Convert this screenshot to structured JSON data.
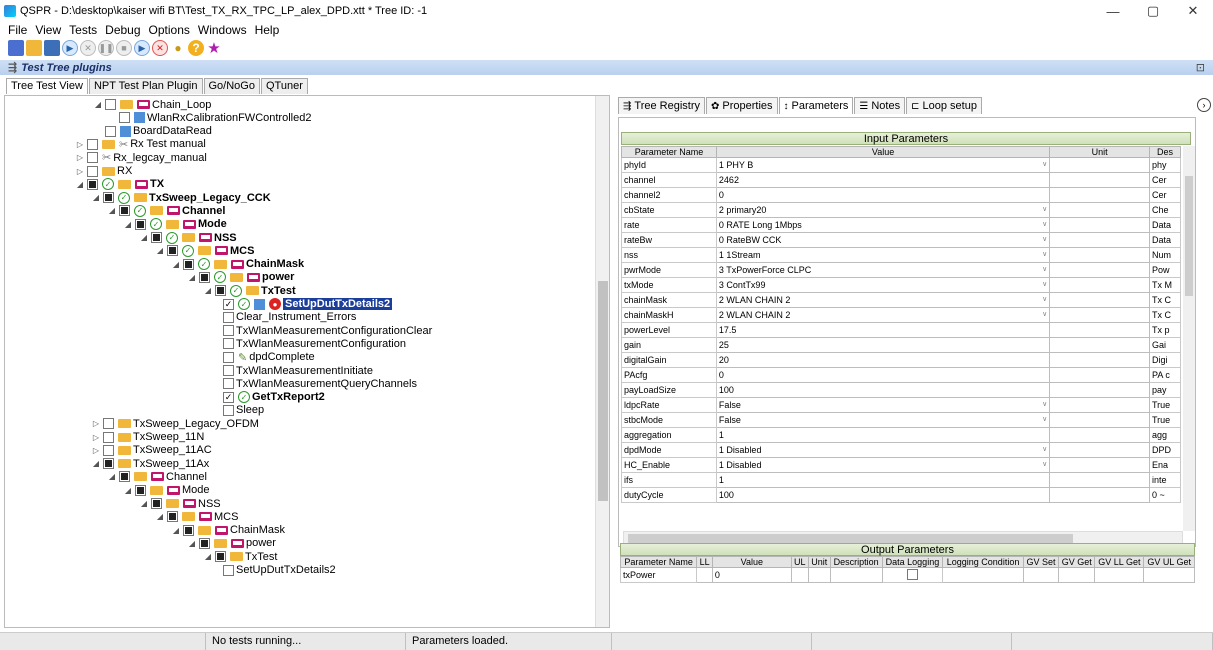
{
  "window": {
    "title": "QSPR - D:\\desktop\\kaiser wifi BT\\Test_TX_RX_TPC_LP_alex_DPD.xtt * Tree ID: -1"
  },
  "menu": [
    "File",
    "View",
    "Tests",
    "Debug",
    "Options",
    "Windows",
    "Help"
  ],
  "plugins": {
    "title": "Test Tree plugins"
  },
  "main_tabs": [
    "Tree Test View",
    "NPT Test Plan Plugin",
    "Go/NoGo",
    "QTuner"
  ],
  "tree": [
    {
      "indent": 88,
      "tw": "◢",
      "cb": "",
      "ok": false,
      "icon": "folder-loop",
      "label": "Chain_Loop",
      "bold": false
    },
    {
      "indent": 112,
      "tw": "",
      "cb": "",
      "ok": false,
      "icon": "blue",
      "label": "WlanRxCalibrationFWControlled2",
      "bold": false
    },
    {
      "indent": 98,
      "tw": "",
      "cb": "",
      "ok": false,
      "icon": "blue",
      "label": "BoardDataRead",
      "bold": false
    },
    {
      "indent": 70,
      "tw": "▷",
      "cb": "",
      "ok": false,
      "icon": "folder-tools",
      "label": "Rx Test manual",
      "bold": false
    },
    {
      "indent": 70,
      "tw": "▷",
      "cb": "",
      "ok": false,
      "icon": "tools",
      "label": "Rx_legcay_manual",
      "bold": false
    },
    {
      "indent": 70,
      "tw": "▷",
      "cb": "",
      "ok": false,
      "icon": "folder",
      "label": "RX",
      "bold": false
    },
    {
      "indent": 70,
      "tw": "◢",
      "cb": "fill",
      "ok": true,
      "icon": "folder-loop",
      "label": "TX",
      "bold": true
    },
    {
      "indent": 86,
      "tw": "◢",
      "cb": "fill",
      "ok": true,
      "icon": "folder",
      "label": "TxSweep_Legacy_CCK",
      "bold": true
    },
    {
      "indent": 102,
      "tw": "◢",
      "cb": "fill",
      "ok": true,
      "icon": "folder-loop",
      "label": "Channel",
      "bold": true
    },
    {
      "indent": 118,
      "tw": "◢",
      "cb": "fill",
      "ok": true,
      "icon": "folder-loop",
      "label": "Mode",
      "bold": true
    },
    {
      "indent": 134,
      "tw": "◢",
      "cb": "fill",
      "ok": true,
      "icon": "folder-loop",
      "label": "NSS",
      "bold": true
    },
    {
      "indent": 150,
      "tw": "◢",
      "cb": "fill",
      "ok": true,
      "icon": "folder-loop",
      "label": "MCS",
      "bold": true
    },
    {
      "indent": 166,
      "tw": "◢",
      "cb": "fill",
      "ok": true,
      "icon": "folder-loop",
      "label": "ChainMask",
      "bold": true
    },
    {
      "indent": 182,
      "tw": "◢",
      "cb": "fill",
      "ok": true,
      "icon": "folder-loop",
      "label": "power",
      "bold": true
    },
    {
      "indent": 198,
      "tw": "◢",
      "cb": "fill",
      "ok": true,
      "icon": "folder",
      "label": "TxTest",
      "bold": true
    },
    {
      "indent": 216,
      "tw": "",
      "cb": "check",
      "ok": true,
      "icon": "selected",
      "label": "SetUpDutTxDetails2",
      "bold": true
    },
    {
      "indent": 216,
      "tw": "",
      "cb": "",
      "ok": false,
      "icon": "none",
      "label": "Clear_Instrument_Errors",
      "bold": false
    },
    {
      "indent": 216,
      "tw": "",
      "cb": "",
      "ok": false,
      "icon": "none",
      "label": "TxWlanMeasurementConfigurationClear",
      "bold": false
    },
    {
      "indent": 216,
      "tw": "",
      "cb": "",
      "ok": false,
      "icon": "none",
      "label": "TxWlanMeasurementConfiguration",
      "bold": false
    },
    {
      "indent": 216,
      "tw": "",
      "cb": "",
      "ok": false,
      "icon": "dpd",
      "label": "dpdComplete",
      "bold": false
    },
    {
      "indent": 216,
      "tw": "",
      "cb": "",
      "ok": false,
      "icon": "none",
      "label": "TxWlanMeasurementInitiate",
      "bold": false
    },
    {
      "indent": 216,
      "tw": "",
      "cb": "",
      "ok": false,
      "icon": "none",
      "label": "TxWlanMeasurementQueryChannels",
      "bold": false
    },
    {
      "indent": 216,
      "tw": "",
      "cb": "check",
      "ok": true,
      "icon": "none",
      "label": "GetTxReport2",
      "bold": true
    },
    {
      "indent": 216,
      "tw": "",
      "cb": "",
      "ok": false,
      "icon": "none",
      "label": "Sleep",
      "bold": false
    },
    {
      "indent": 86,
      "tw": "▷",
      "cb": "",
      "ok": false,
      "icon": "folder",
      "label": "TxSweep_Legacy_OFDM",
      "bold": false
    },
    {
      "indent": 86,
      "tw": "▷",
      "cb": "",
      "ok": false,
      "icon": "folder",
      "label": "TxSweep_11N",
      "bold": false
    },
    {
      "indent": 86,
      "tw": "▷",
      "cb": "",
      "ok": false,
      "icon": "folder",
      "label": "TxSweep_11AC",
      "bold": false
    },
    {
      "indent": 86,
      "tw": "◢",
      "cb": "fill",
      "ok": false,
      "icon": "folder",
      "label": "TxSweep_11Ax",
      "bold": false
    },
    {
      "indent": 102,
      "tw": "◢",
      "cb": "fill",
      "ok": false,
      "icon": "folder-loop",
      "label": "Channel",
      "bold": false
    },
    {
      "indent": 118,
      "tw": "◢",
      "cb": "fill",
      "ok": false,
      "icon": "folder-loop",
      "label": "Mode",
      "bold": false
    },
    {
      "indent": 134,
      "tw": "◢",
      "cb": "fill",
      "ok": false,
      "icon": "folder-loop",
      "label": "NSS",
      "bold": false
    },
    {
      "indent": 150,
      "tw": "◢",
      "cb": "fill",
      "ok": false,
      "icon": "folder-loop",
      "label": "MCS",
      "bold": false
    },
    {
      "indent": 166,
      "tw": "◢",
      "cb": "fill",
      "ok": false,
      "icon": "folder-loop",
      "label": "ChainMask",
      "bold": false
    },
    {
      "indent": 182,
      "tw": "◢",
      "cb": "fill",
      "ok": false,
      "icon": "folder-loop",
      "label": "power",
      "bold": false
    },
    {
      "indent": 198,
      "tw": "◢",
      "cb": "fill",
      "ok": false,
      "icon": "folder",
      "label": "TxTest",
      "bold": false
    },
    {
      "indent": 216,
      "tw": "",
      "cb": "",
      "ok": false,
      "icon": "none",
      "label": "SetUpDutTxDetails2",
      "bold": false
    }
  ],
  "right_tabs": [
    {
      "icon": "tree-registry-icon",
      "glyph": "⇶",
      "label": "Tree Registry"
    },
    {
      "icon": "properties-icon",
      "glyph": "✿",
      "label": "Properties"
    },
    {
      "icon": "parameters-icon",
      "glyph": "↕",
      "label": "Parameters"
    },
    {
      "icon": "notes-icon",
      "glyph": "☰",
      "label": "Notes"
    },
    {
      "icon": "loop-setup-icon",
      "glyph": "⊏",
      "label": "Loop setup"
    }
  ],
  "input_params": {
    "title": "Input Parameters",
    "headers": [
      "Parameter Name",
      "Value",
      "Unit",
      "Des"
    ],
    "rows": [
      {
        "name": "phyId",
        "value": "1 PHY B",
        "combo": true,
        "desc": "phy"
      },
      {
        "name": "channel",
        "value": "2462",
        "combo": false,
        "desc": "Cer"
      },
      {
        "name": "channel2",
        "value": "0",
        "combo": false,
        "desc": "Cer"
      },
      {
        "name": "cbState",
        "value": "2 primary20",
        "combo": true,
        "desc": "Che"
      },
      {
        "name": "rate",
        "value": "0 RATE Long 1Mbps",
        "combo": true,
        "desc": "Data"
      },
      {
        "name": "rateBw",
        "value": "0 RateBW CCK",
        "combo": true,
        "desc": "Data"
      },
      {
        "name": "nss",
        "value": "1 1Stream",
        "combo": true,
        "desc": "Num"
      },
      {
        "name": "pwrMode",
        "value": "3 TxPowerForce CLPC",
        "combo": true,
        "desc": "Pow"
      },
      {
        "name": "txMode",
        "value": "3 ContTx99",
        "combo": true,
        "desc": "Tx M"
      },
      {
        "name": "chainMask",
        "value": "2 WLAN CHAIN 2",
        "combo": true,
        "desc": "Tx C"
      },
      {
        "name": "chainMaskH",
        "value": "2 WLAN CHAIN 2",
        "combo": true,
        "desc": "Tx C"
      },
      {
        "name": "powerLevel",
        "value": "17.5",
        "combo": false,
        "desc": "Tx p"
      },
      {
        "name": "gain",
        "value": "25",
        "combo": false,
        "desc": "Gai"
      },
      {
        "name": "digitalGain",
        "value": "20",
        "combo": false,
        "desc": "Digi"
      },
      {
        "name": "PAcfg",
        "value": "0",
        "combo": false,
        "desc": "PA c"
      },
      {
        "name": "payLoadSize",
        "value": "100",
        "combo": false,
        "desc": "pay"
      },
      {
        "name": "ldpcRate",
        "value": "False",
        "combo": true,
        "desc": "True"
      },
      {
        "name": "stbcMode",
        "value": "False",
        "combo": true,
        "desc": "True"
      },
      {
        "name": "aggregation",
        "value": "1",
        "combo": false,
        "desc": "agg"
      },
      {
        "name": "dpdMode",
        "value": "1 Disabled",
        "combo": true,
        "desc": "DPD"
      },
      {
        "name": "HC_Enable",
        "value": "1 Disabled",
        "combo": true,
        "desc": "Ena"
      },
      {
        "name": "ifs",
        "value": "1",
        "combo": false,
        "desc": "inte"
      },
      {
        "name": "dutyCycle",
        "value": "100",
        "combo": false,
        "desc": "0 ~"
      }
    ]
  },
  "output_params": {
    "title": "Output Parameters",
    "headers": [
      "Parameter Name",
      "LL",
      "Value",
      "UL",
      "Unit",
      "Description",
      "Data Logging",
      "Logging Condition",
      "GV Set",
      "GV Get",
      "GV LL Get",
      "GV UL Get"
    ],
    "rows": [
      {
        "name": "txPower",
        "value": "0"
      }
    ]
  },
  "status": {
    "running": "No tests running...",
    "message": "Parameters loaded."
  }
}
